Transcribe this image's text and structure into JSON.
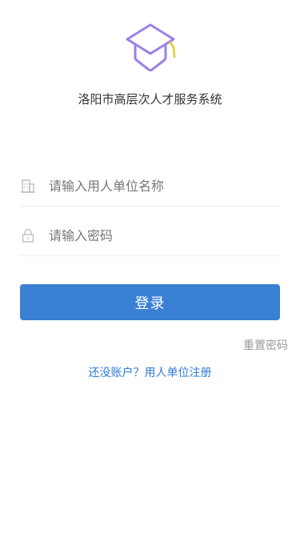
{
  "app": {
    "title": "洛阳市高层次人才服务系统",
    "logo_icon": "graduation-cap-icon",
    "logo_color": "#9b80e8",
    "logo_tassel_color": "#e3cc2b"
  },
  "form": {
    "org_name": {
      "icon": "building-icon",
      "placeholder": "请输入用人单位名称",
      "value": ""
    },
    "password": {
      "icon": "lock-icon",
      "placeholder": "请输入密码",
      "value": ""
    }
  },
  "actions": {
    "login_label": "登录",
    "reset_password_label": "重置密码",
    "register_label": "还没账户？用人单位注册"
  },
  "colors": {
    "primary": "#3a80d5",
    "link": "#2f7bd3",
    "muted": "#999999"
  }
}
